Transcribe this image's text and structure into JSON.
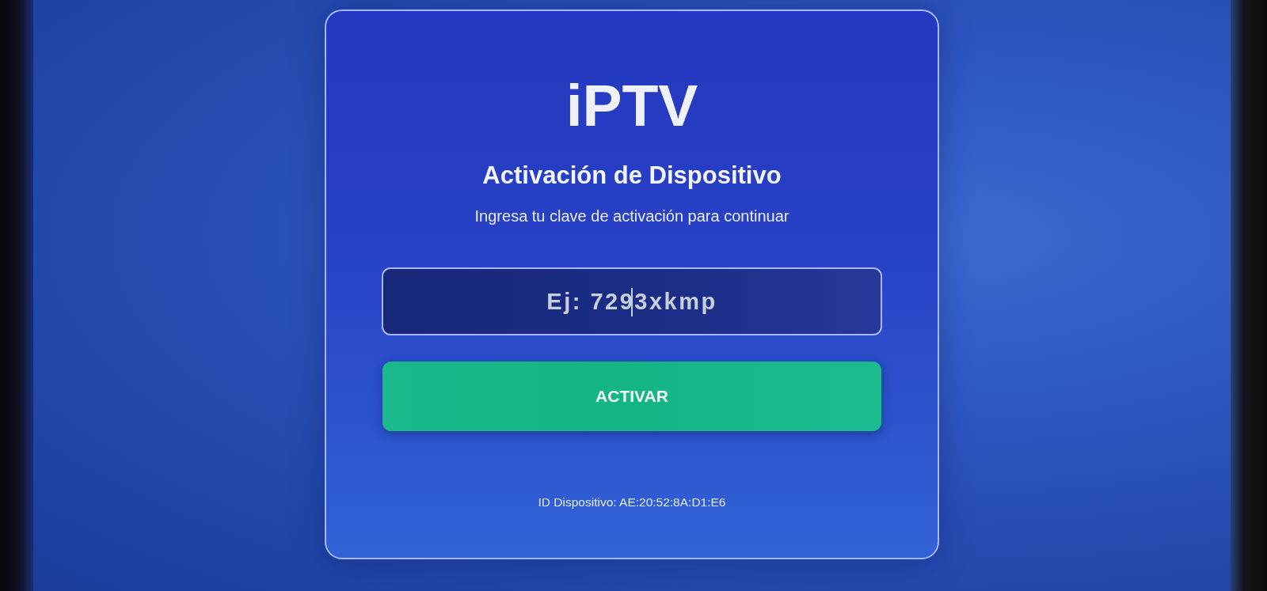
{
  "app": {
    "title": "iPTV"
  },
  "activation": {
    "heading": "Activación de Dispositivo",
    "subtitle": "Ingresa tu clave de activación para continuar",
    "key_field": {
      "placeholder": "Ej: 7293xkmp",
      "focused": true
    },
    "button": {
      "label": "ACTIVAR"
    },
    "device_id": "ID Dispositivo: AE:20:52:8A:D1:E6"
  }
}
